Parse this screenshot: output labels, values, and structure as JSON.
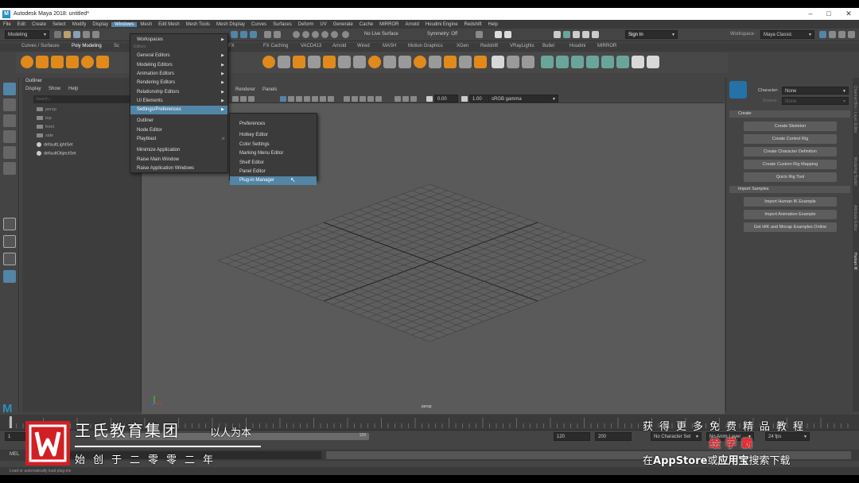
{
  "app": {
    "title": "Autodesk Maya 2018: untitled*",
    "window_controls": [
      "–",
      "□",
      "✕"
    ]
  },
  "menubar": {
    "items": [
      "File",
      "Edit",
      "Create",
      "Select",
      "Modify",
      "Display",
      "Windows",
      "Mesh",
      "Edit Mesh",
      "Mesh Tools",
      "Mesh Display",
      "Curves",
      "Surfaces",
      "Deform",
      "UV",
      "Generate",
      "Cache",
      "MIRROR",
      "Arnold",
      "Houdini Engine",
      "Redshift",
      "Help"
    ],
    "active_index": 6
  },
  "statusline": {
    "mode": "Modeling",
    "live_surface": "No Live Surface",
    "symmetry": "Symmetry: Off",
    "sign_in": "Sign In",
    "workspace_label": "Workspace :",
    "workspace": "Maya Classic"
  },
  "shelf": {
    "tabs": [
      "Curves / Surfaces",
      "Poly Modeling",
      "Sc",
      "FX",
      "FX Caching",
      "VACD413",
      "Arnold",
      "Wired",
      "MASH",
      "Motion Graphics",
      "XGen",
      "Redshift",
      "VRayLights",
      "Bullet",
      "Houdini",
      "MIRROR"
    ],
    "active_tab_index": 1,
    "colors": {
      "orange": "#e08a1c",
      "grey": "#9a9a9a",
      "teal": "#6aa59b",
      "white": "#d8d8d8"
    }
  },
  "outliner": {
    "title": "Outliner",
    "menu": [
      "Display",
      "Show",
      "Help"
    ],
    "search_placeholder": "Search...",
    "items": [
      "persp",
      "top",
      "front",
      "side",
      "defaultLightSet",
      "defaultObjectSet"
    ]
  },
  "windows_menu": {
    "items": [
      {
        "label": "Workspaces",
        "submenu": true
      },
      {
        "label": "Editors",
        "section": true
      },
      {
        "label": "General Editors",
        "submenu": true
      },
      {
        "label": "Modeling Editors",
        "submenu": true
      },
      {
        "label": "Animation Editors",
        "submenu": true
      },
      {
        "label": "Rendering Editors",
        "submenu": true
      },
      {
        "label": "Relationship Editors",
        "submenu": true
      },
      {
        "label": "UI Elements",
        "submenu": true
      },
      {
        "label": "Settings/Preferences",
        "submenu": true,
        "highlighted": true
      },
      {
        "label": "Outliner"
      },
      {
        "label": "Node Editor"
      },
      {
        "label": "Playblast"
      },
      {
        "label": "Minimize Application"
      },
      {
        "label": "Raise Main Window"
      },
      {
        "label": "Raise Application Windows"
      }
    ]
  },
  "prefs_submenu": {
    "items": [
      "Preferences",
      "Hotkey Editor",
      "Color Settings",
      "Marking Menu Editor",
      "Shelf Editor",
      "Panel Editor",
      "Plug-in Manager"
    ],
    "highlighted_index": 6
  },
  "viewport": {
    "menu": [
      "Renderer",
      "Panels"
    ],
    "exposure": "0.00",
    "gamma": "1.00",
    "colorspace": "sRGB gamma",
    "camera_label": "persp"
  },
  "character_panel": {
    "character_label": "Character:",
    "character_value": "None",
    "source_label": "Source:",
    "source_value": "None",
    "create_section": "Create",
    "create_buttons": [
      "Create Skeleton",
      "Create Control Rig",
      "Create Character Definition",
      "Create Custom Rig Mapping",
      "Quick Rig Tool"
    ],
    "import_section": "Import Samples",
    "import_buttons": [
      "Import Human IK Example",
      "Import Animation Example",
      "Get HIK and Mocap Examples Online"
    ],
    "side_tabs": [
      "Channel Box / Layer Editor",
      "Modeling Toolkit",
      "Attribute Editor",
      "Human IK"
    ]
  },
  "timeline": {
    "start": "1",
    "current": "1",
    "range_end": "120",
    "end": "120",
    "end2": "200",
    "character_set": "No Character Set",
    "anim_layer": "No Anim Layer",
    "fps": "24 fps",
    "command_language": "MEL",
    "help_text": "Load or automatically load plug-ins"
  },
  "watermark": {
    "org": "王氏教育集团",
    "slogan": "以人为本",
    "founded": "始创于二零零二年",
    "r1": "获得更多免费精品教程",
    "r2": "绘学霸",
    "r3_a": "在",
    "r3_b": "AppStore",
    "r3_c": "或",
    "r3_d": "应用宝",
    "r3_e": "搜索下载",
    "brand_color": "#d11f24"
  }
}
